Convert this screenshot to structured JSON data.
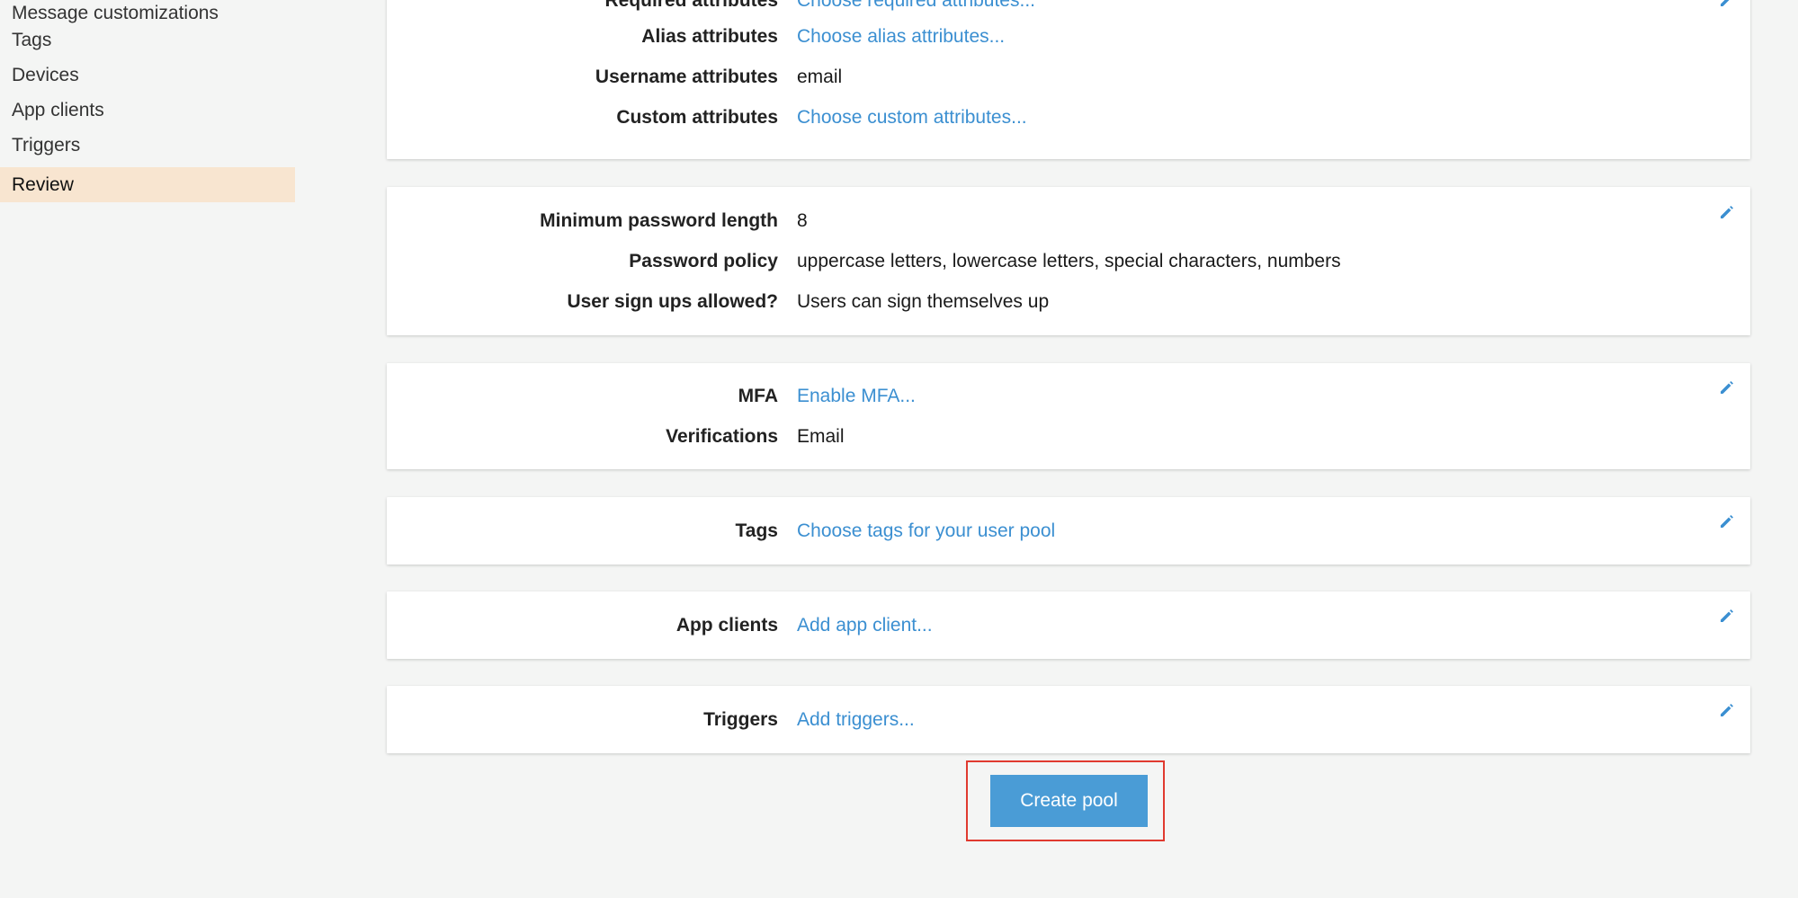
{
  "sidebar": {
    "items": [
      {
        "label": "Message customizations"
      },
      {
        "label": "Tags"
      },
      {
        "label": "Devices"
      },
      {
        "label": "App clients"
      },
      {
        "label": "Triggers"
      },
      {
        "label": "Review",
        "active": true
      }
    ]
  },
  "sections": {
    "attributes": {
      "required": {
        "label": "Required attributes",
        "value": "Choose required attributes..."
      },
      "alias": {
        "label": "Alias attributes",
        "value": "Choose alias attributes..."
      },
      "username": {
        "label": "Username attributes",
        "value": "email"
      },
      "custom": {
        "label": "Custom attributes",
        "value": "Choose custom attributes..."
      }
    },
    "policies": {
      "min_length": {
        "label": "Minimum password length",
        "value": "8"
      },
      "policy": {
        "label": "Password policy",
        "value": "uppercase letters, lowercase letters, special characters, numbers"
      },
      "signups": {
        "label": "User sign ups allowed?",
        "value": "Users can sign themselves up"
      }
    },
    "mfa": {
      "mfa": {
        "label": "MFA",
        "value": "Enable MFA..."
      },
      "verifications": {
        "label": "Verifications",
        "value": "Email"
      }
    },
    "tags": {
      "tags": {
        "label": "Tags",
        "value": "Choose tags for your user pool"
      }
    },
    "app_clients": {
      "app_clients": {
        "label": "App clients",
        "value": "Add app client..."
      }
    },
    "triggers": {
      "triggers": {
        "label": "Triggers",
        "value": "Add triggers..."
      }
    }
  },
  "actions": {
    "create_pool_label": "Create pool"
  },
  "colors": {
    "link": "#3b8fd1",
    "active_nav_bg": "#f8e5d0",
    "primary_button": "#4a9cd6",
    "highlight_frame": "#e03a2f"
  }
}
